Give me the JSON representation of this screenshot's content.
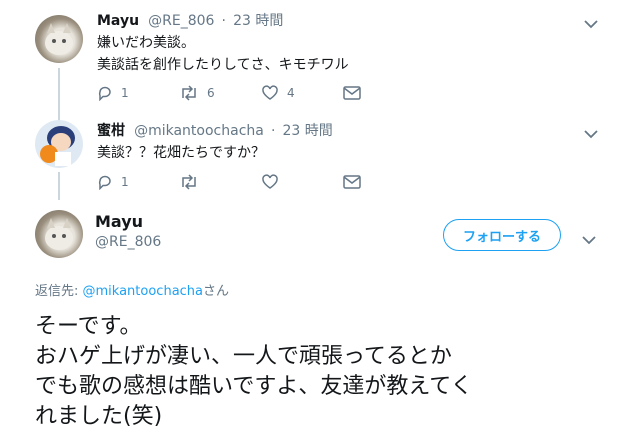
{
  "tweet1": {
    "name": "Mayu",
    "handle": "@RE_806",
    "sep": "·",
    "time": "23 時間",
    "line1": "嫌いだわ美談。",
    "line2": "美談話を創作したりしてさ、キモチワル",
    "replies": "1",
    "retweets": "6",
    "likes": "4"
  },
  "tweet2": {
    "name": "蜜柑",
    "handle": "@mikantoochacha",
    "sep": "·",
    "time": "23 時間",
    "text": "美談？？花畑たちですか？",
    "replies": "1"
  },
  "main": {
    "name": "Mayu",
    "handle": "@RE_806",
    "follow_label": "フォローする",
    "reply_prefix": "返信先: ",
    "reply_user": "@mikantoochacha",
    "reply_suffix": "さん",
    "line1": "そーです。",
    "line2": "おハゲ上げが凄い、一人で頑張ってるとか",
    "line3": "でも歌の感想は酷いですよ、友達が教えてく",
    "line4": "れました(笑)"
  },
  "colors": {
    "accent": "#1da1f2",
    "muted": "#657786",
    "text": "#14171a",
    "thread": "#ccd6dd"
  },
  "icons": [
    "reply-icon",
    "retweet-icon",
    "like-icon",
    "dm-icon",
    "chevron-down-icon"
  ]
}
